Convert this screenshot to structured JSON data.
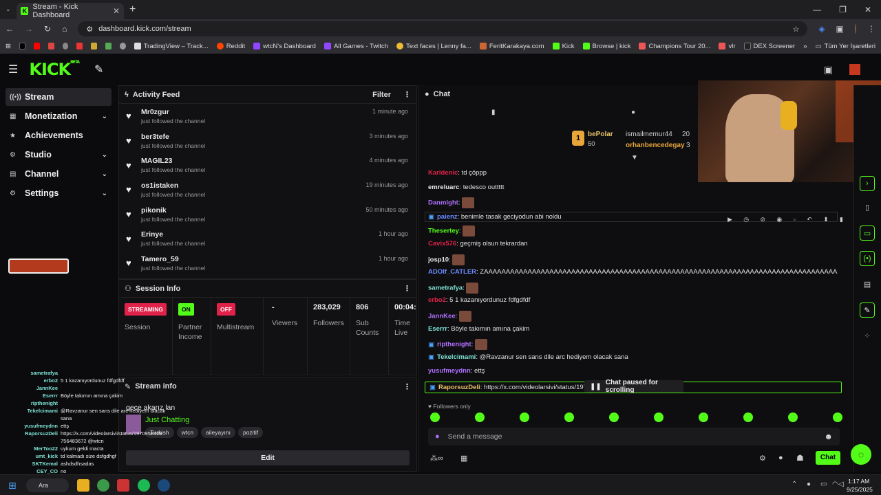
{
  "browser": {
    "tab_title": "Stream - Kick Dashboard",
    "url": "dashboard.kick.com/stream",
    "bookmarks": [
      "TradingView – Track...",
      "Reddit",
      "wtcN's Dashboard",
      "All Games - Twitch",
      "Text faces | Lenny fa...",
      "FeritKarakaya.com",
      "Kick",
      "Browse | kick",
      "Champions Tour 20...",
      "vlr",
      "DEX Screener"
    ],
    "all_bookmarks": "Tüm Yer İşaretleri"
  },
  "app": {
    "logo": "KICK",
    "beta": "BETA"
  },
  "sidebar": {
    "items": [
      {
        "label": "Stream",
        "icon": "broadcast-icon"
      },
      {
        "label": "Monetization",
        "icon": "money-icon"
      },
      {
        "label": "Achievements",
        "icon": "star-icon"
      },
      {
        "label": "Studio",
        "icon": "gear-icon"
      },
      {
        "label": "Channel",
        "icon": "channel-icon"
      },
      {
        "label": "Settings",
        "icon": "settings-icon"
      }
    ]
  },
  "activity_feed": {
    "title": "Activity Feed",
    "filter": "Filter",
    "items": [
      {
        "name": "Mr0zgur",
        "action": "just followed the channel",
        "time": "1 minute ago"
      },
      {
        "name": "ber3tefe",
        "action": "just followed the channel",
        "time": "3 minutes ago"
      },
      {
        "name": "MAGIL23",
        "action": "just followed the channel",
        "time": "4 minutes ago"
      },
      {
        "name": "os1istaken",
        "action": "just followed the channel",
        "time": "19 minutes ago"
      },
      {
        "name": "pikonik",
        "action": "just followed the channel",
        "time": "50 minutes ago"
      },
      {
        "name": "Erinye",
        "action": "just followed the channel",
        "time": "1 hour ago"
      },
      {
        "name": "Tamero_59",
        "action": "just followed the channel",
        "time": "1 hour ago"
      }
    ]
  },
  "session_info": {
    "title": "Session Info",
    "streaming_badge": "STREAMING",
    "session_label": "Session",
    "partner_badge": "ON",
    "partner_label": "Partner Income",
    "multistream_badge": "OFF",
    "multistream_label": "Multistream",
    "viewers_value": "-",
    "viewers_label": "Viewers",
    "followers_value": "283,029",
    "followers_label": "Followers",
    "subs_value": "806",
    "subs_label": "Sub Counts",
    "time_value": "00:04:",
    "time_label": "Time Live"
  },
  "stream_info": {
    "title": "Stream info",
    "stream_title": "gece akarız lan",
    "category": "Just Chatting",
    "tags": [
      "Turkish",
      "wtcn",
      "aileyayını",
      "pozitif"
    ],
    "edit": "Edit"
  },
  "chat": {
    "title": "Chat",
    "leaders": [
      {
        "name": "bePolar",
        "value": "50"
      },
      {
        "name": "ismailmemur44",
        "value": "20"
      },
      {
        "name": "orhanbencedegay",
        "value": "3"
      }
    ],
    "messages": [
      {
        "user": "Karldenic",
        "color": "#e0224a",
        "text": ": td çöppp"
      },
      {
        "user": "emreluarc",
        "color": "#e8e8e8",
        "text": ": tedesco outtttt"
      },
      {
        "user": "Danmight",
        "color": "#b070ff",
        "text": ":"
      },
      {
        "user": "paienz",
        "color": "#6b8cff",
        "text": ": benimle tasak geciyodun abi noldu"
      },
      {
        "user": "Thesertey",
        "color": "#53fc18",
        "text": ":"
      },
      {
        "user": "Cavix576",
        "color": "#e0224a",
        "text": ": geçmiş olsun tekrardan"
      },
      {
        "user": "josp10",
        "color": "#e8e8e8",
        "text": ":"
      },
      {
        "user": "ADOIf_CATLER",
        "color": "#6b8cff",
        "text": ": ZAAAAAAAAAAAAAAAAAAAAAAAAAAAAAAAAAAAAAAAAAAAAAAAAAAAAAAAAAAAAAAAAAAAAAAAAAAAAAAAAA"
      },
      {
        "user": "sametrafya",
        "color": "#7fe3d6",
        "text": ":"
      },
      {
        "user": "erbo2",
        "color": "#e0224a",
        "text": ": 5 1 kazanıyordunuz fdfgdfdf"
      },
      {
        "user": "JannKee",
        "color": "#b070ff",
        "text": ":"
      },
      {
        "user": "Eserrr",
        "color": "#7fe3d6",
        "text": ": Böyle takımın amına çakim"
      },
      {
        "user": "ripthenight",
        "color": "#b070ff",
        "text": ":"
      },
      {
        "user": "Tekelcimami",
        "color": "#7fe3d6",
        "text": ": @Ravzanur sen sans dile arc hediyem olacak sana"
      },
      {
        "user": "yusufmeydnn",
        "color": "#b070ff",
        "text": ": ettş"
      },
      {
        "user": "RaporsuzDeli",
        "color": "#e8c16a",
        "text": ": https://x.com/videolarsivi/status/1970"
      }
    ],
    "paused": "Chat paused for scrolling",
    "followers_only": "Followers only",
    "input_placeholder": "Send a message",
    "send": "Chat"
  },
  "overlay_chat": [
    {
      "user": "sametrafya",
      "text": ""
    },
    {
      "user": "erbo2",
      "text": "5 1 kazanıyordunuz fdfgdfdf"
    },
    {
      "user": "JannKee",
      "text": ""
    },
    {
      "user": "Eserrr",
      "text": "Böyle takımın amına çakim"
    },
    {
      "user": "ripthenight",
      "text": ""
    },
    {
      "user": "Tekelcimami",
      "text": "@Ravzanur sen sans dile arc hediyem olacak"
    },
    {
      "user": "",
      "text": "sana"
    },
    {
      "user": "yusufmeydnn",
      "text": "ettş"
    },
    {
      "user": "RaporsuzDeli",
      "text": "https://x.com/videolarsivi/status/1970958409"
    },
    {
      "user": "",
      "text": "756483672 @wtcn"
    },
    {
      "user": "MerToo22",
      "text": "uykum geldi macta"
    },
    {
      "user": "umt_kick",
      "text": "td kalmadı size dsfgdhgf"
    },
    {
      "user": "SKTKemal",
      "text": "ashdsdhsadas"
    },
    {
      "user": "CEY_CO",
      "text": "no"
    }
  ],
  "taskbar": {
    "search": "Ara",
    "time": "1:17 AM",
    "date": "9/25/2025"
  }
}
